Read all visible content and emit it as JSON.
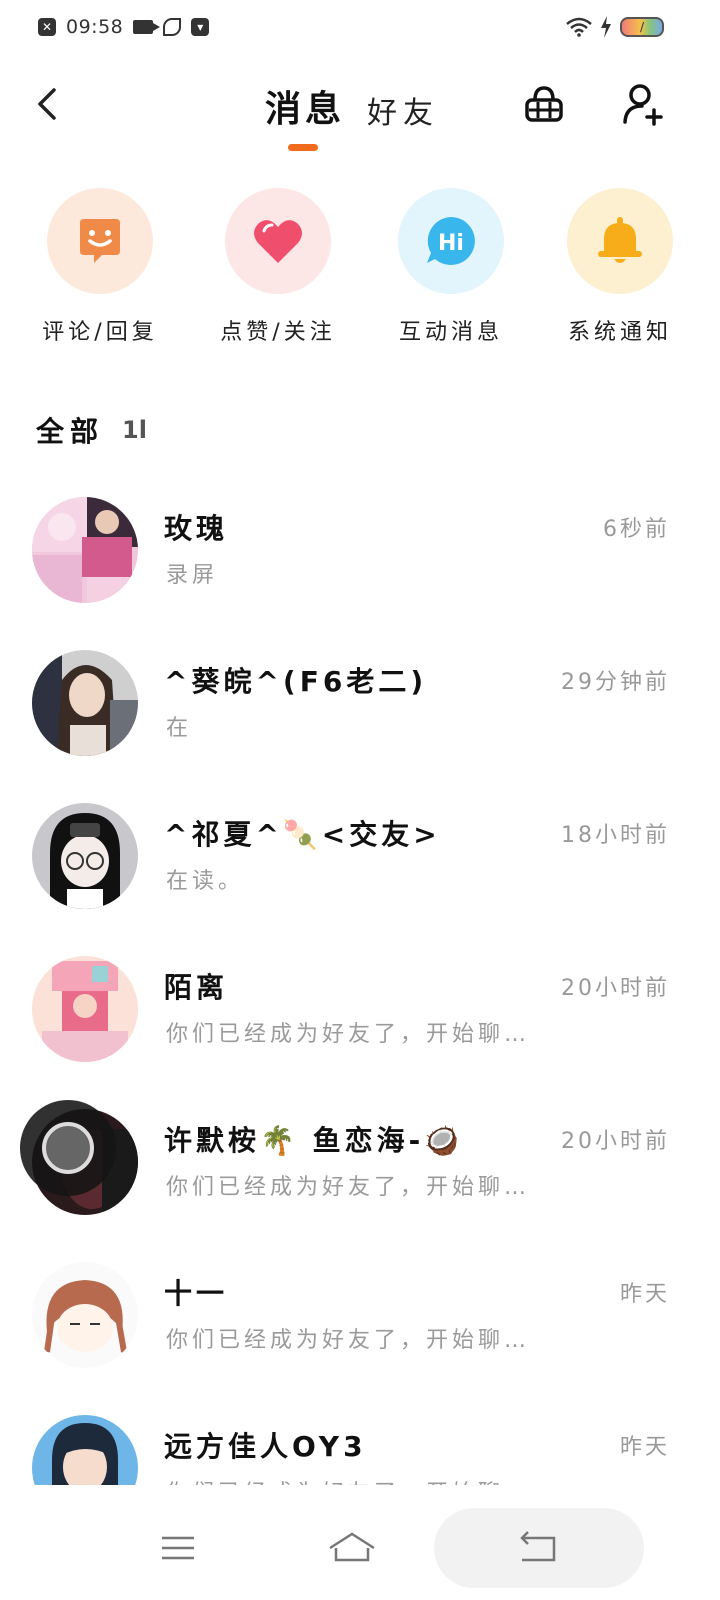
{
  "status_bar": {
    "time": "09:58",
    "battery_text": "/"
  },
  "header": {
    "tab_active": "消息",
    "tab_other": "好友"
  },
  "quick_actions": [
    {
      "label": "评论/回复",
      "icon": "smile-bubble-icon",
      "bg": "#fde9dc",
      "fg": "#f08a48"
    },
    {
      "label": "点赞/关注",
      "icon": "heart-icon",
      "bg": "#fde6e6",
      "fg": "#f04e6d"
    },
    {
      "label": "互动消息",
      "icon": "hi-bubble-icon",
      "bg": "#e2f4fc",
      "fg": "#39b6ec"
    },
    {
      "label": "系统通知",
      "icon": "bell-icon",
      "bg": "#fdf0d0",
      "fg": "#f7ad1a"
    }
  ],
  "section": {
    "title": "全部",
    "sort_icon": "1l"
  },
  "conversations": [
    {
      "name": "玫瑰",
      "time": "6秒前",
      "preview": "录屏"
    },
    {
      "name": "^葵皖^(F6老二)",
      "time": "29分钟前",
      "preview": "在"
    },
    {
      "name": "^祁夏^🍡<交友>",
      "time": "18小时前",
      "preview": "在读。"
    },
    {
      "name": "陌离",
      "time": "20小时前",
      "preview": "你们已经成为好友了，开始聊…"
    },
    {
      "name": "许默桉🌴 鱼恋海-🥥",
      "time": "20小时前",
      "preview": "你们已经成为好友了，开始聊…"
    },
    {
      "name": "十一",
      "time": "昨天",
      "preview": "你们已经成为好友了，开始聊天吧"
    },
    {
      "name": "远方佳人OY3",
      "time": "昨天",
      "preview": "你们已经成为好友了，开始聊天吧"
    }
  ],
  "colors": {
    "accent": "#f26a1b"
  }
}
